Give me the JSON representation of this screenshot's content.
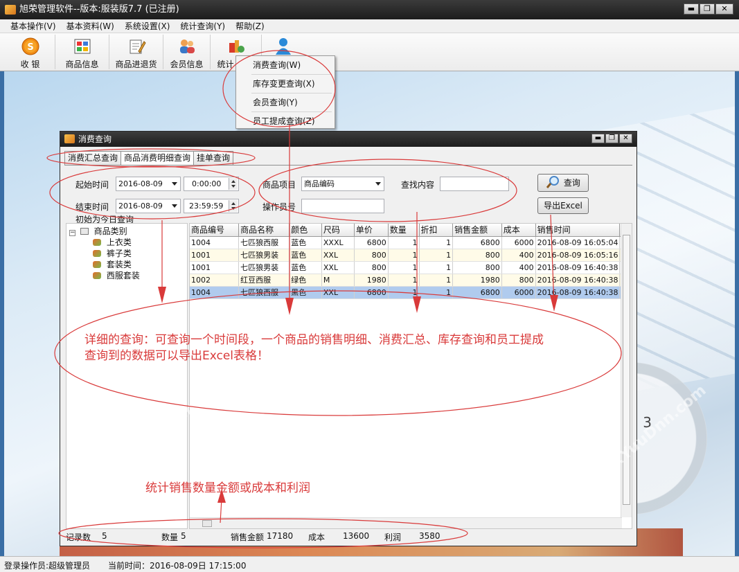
{
  "window": {
    "title": "旭荣管理软件--版本:服装版7.7 (已注册)",
    "controls": [
      "▬",
      "❐",
      "✕"
    ]
  },
  "menubar": [
    "基本操作(V)",
    "基本资料(W)",
    "系统设置(X)",
    "统计查询(Y)",
    "帮助(Z)"
  ],
  "toolbar": [
    {
      "label": "收 银",
      "icon": "cashier-coin-icon"
    },
    {
      "label": "商品信息",
      "icon": "product-grid-icon"
    },
    {
      "label": "商品进退货",
      "icon": "stock-edit-icon"
    },
    {
      "label": "会员信息",
      "icon": "members-icon"
    },
    {
      "label": "统计",
      "icon": "statistics-icon"
    },
    {
      "label": "",
      "icon": "user-icon"
    }
  ],
  "dropdown": [
    "消费查询(W)",
    "库存变更查询(X)",
    "会员查询(Y)",
    "员工提成查询(Z)"
  ],
  "inner": {
    "title": "消费查询",
    "tabs": [
      "消费汇总查询",
      "商品消费明细查询",
      "挂单查询"
    ],
    "active_tab": 1,
    "start_label": "起始时间",
    "start_date": "2016-08-09",
    "start_time": "0:00:00",
    "end_label": "结束时间",
    "end_date": "2016-08-09",
    "end_time": "23:59:59",
    "today_hint": "初始为今日查询",
    "item_label": "商品项目",
    "item_value": "商品编码",
    "search_label": "查找内容",
    "search_value": "",
    "operator_label": "操作员号",
    "operator_value": "",
    "query_button": "查询",
    "export_button": "导出Excel"
  },
  "tree": {
    "root": "商品类别",
    "children": [
      "上衣类",
      "裤子类",
      "套装类",
      "西服套装"
    ]
  },
  "grid": {
    "columns": [
      "商品编号",
      "商品名称",
      "颜色",
      "尺码",
      "单价",
      "数量",
      "折扣",
      "销售金额",
      "成本",
      "销售时间",
      "..."
    ],
    "rows": [
      [
        "1004",
        "七匹狼西服",
        "蓝色",
        "XXXL",
        "6800",
        "1",
        "1",
        "6800",
        "6000",
        "2016-08-09 16:05:04"
      ],
      [
        "1001",
        "七匹狼男装",
        "蓝色",
        "XXL",
        "800",
        "1",
        "1",
        "800",
        "400",
        "2016-08-09 16:05:16"
      ],
      [
        "1001",
        "七匹狼男装",
        "蓝色",
        "XXL",
        "800",
        "1",
        "1",
        "800",
        "400",
        "2016-08-09 16:40:38"
      ],
      [
        "1002",
        "红豆西服",
        "绿色",
        "M",
        "1980",
        "1",
        "1",
        "1980",
        "800",
        "2016-08-09 16:40:38"
      ],
      [
        "1004",
        "七匹狼西服",
        "黑色",
        "XXL",
        "6800",
        "1",
        "1",
        "6800",
        "6000",
        "2016-08-09 16:40:38"
      ]
    ],
    "selected_row": 4
  },
  "summary": {
    "records_label": "记录数",
    "records": "5",
    "qty_label": "数量",
    "qty": "5",
    "sales_label": "销售金额",
    "sales": "17180",
    "cost_label": "成本",
    "cost": "13600",
    "profit_label": "利润",
    "profit": "3580"
  },
  "statusbar": {
    "operator": "登录操作员:超级管理员",
    "time": "当前时间：2016-08-09日 17:15:00"
  },
  "annotations": {
    "main_line1": "详细的查询：可查询一个时间段，一个商品的销售明细、消费汇总、库存查询和员工提成",
    "main_line2": "查询到的数据可以导出Excel表格！",
    "bottom": "统计销售数量金额或成本和利润",
    "color": "#d93a3a"
  },
  "watermark": "www.YuuDnn.com"
}
